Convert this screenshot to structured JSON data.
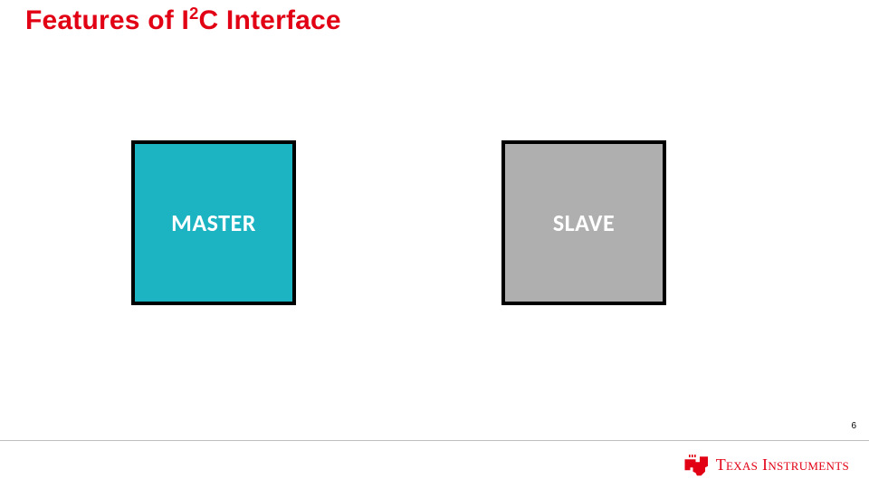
{
  "title": {
    "pre": "Features of I",
    "sup": "2",
    "post": "C Interface"
  },
  "blocks": {
    "master": {
      "label": "MASTER",
      "fill": "#1cb4c2"
    },
    "slave": {
      "label": "SLAVE",
      "fill": "#afafaf"
    }
  },
  "page_number": "6",
  "footer": {
    "brand_first": "Texas",
    "brand_second": " Instruments",
    "logo_color": "#e20015"
  }
}
